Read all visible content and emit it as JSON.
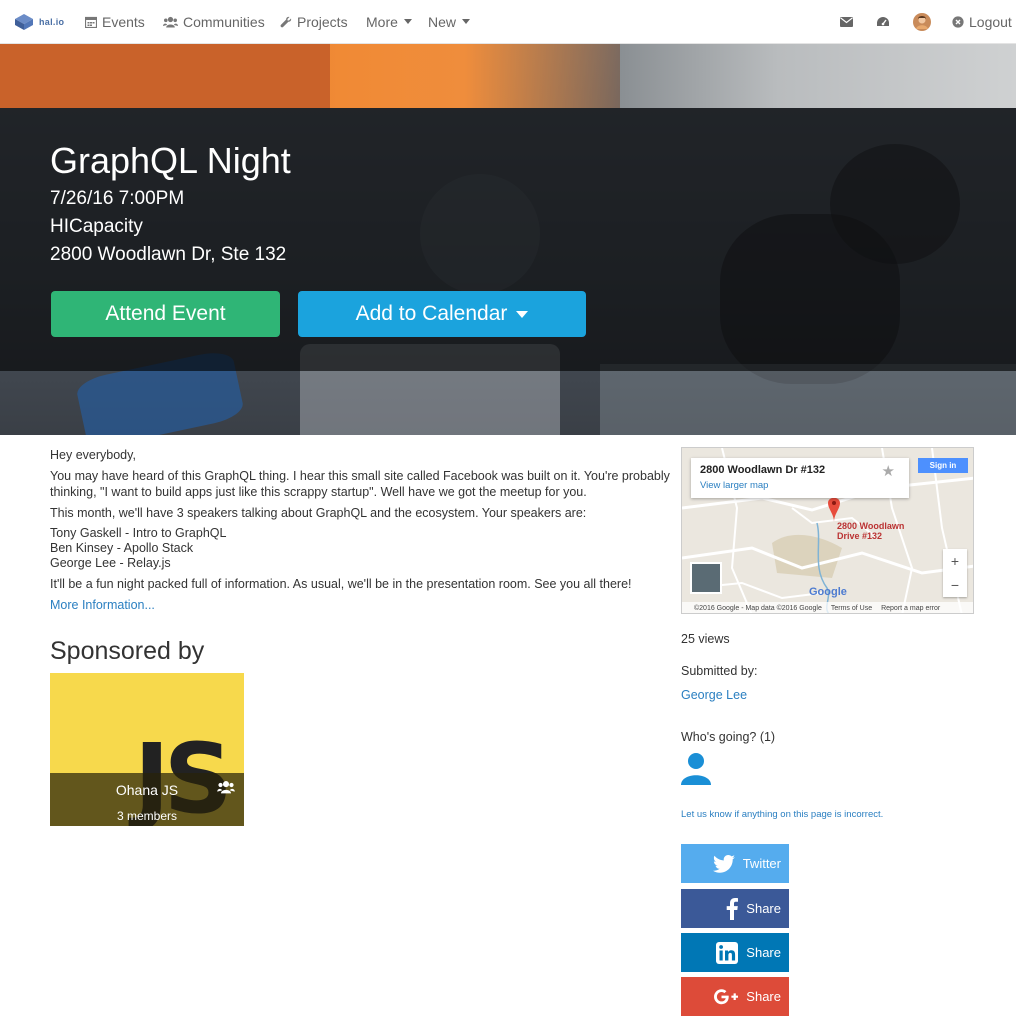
{
  "nav": {
    "logo_text": "hal.io",
    "items": [
      {
        "label": "Events",
        "icon": "calendar-icon"
      },
      {
        "label": "Communities",
        "icon": "users-icon"
      },
      {
        "label": "Projects",
        "icon": "wrench-icon"
      },
      {
        "label": "More",
        "icon": "caret-down-icon"
      },
      {
        "label": "New",
        "icon": "caret-down-icon"
      }
    ],
    "logout_label": "Logout"
  },
  "event": {
    "title": "GraphQL Night",
    "datetime": "7/26/16 7:00PM",
    "venue": "HICapacity",
    "address": "2800 Woodlawn Dr, Ste 132",
    "attend_label": "Attend Event",
    "calendar_label": "Add to Calendar"
  },
  "description": {
    "greeting": "Hey everybody,",
    "para1": "You may have heard of this GraphQL thing. I hear this small site called Facebook was built on it. You're probably thinking, \"I want to build apps just like this scrappy startup\". Well have we got the meetup for you.",
    "para2": "This month, we'll have 3 speakers talking about GraphQL and the ecosystem. Your speakers are:",
    "speakers": [
      "Tony Gaskell - Intro to GraphQL",
      "Ben Kinsey - Apollo Stack",
      "George Lee - Relay.js"
    ],
    "para3": "It'll be a fun night packed full of information. As usual, we'll be in the presentation room. See you all there!",
    "more_link": "More Information..."
  },
  "sponsors": {
    "heading": "Sponsored by",
    "name": "Ohana JS",
    "members": "3 members",
    "logo_text": "JS"
  },
  "map": {
    "title": "2800 Woodlawn Dr #132",
    "larger_link": "View larger map",
    "signin": "Sign in",
    "pin_label_1": "2800 Woodlawn",
    "pin_label_2": "Drive #132",
    "google": "Google",
    "attribution": "©2016 Google - Map data ©2016 Google",
    "terms": "Terms of Use",
    "report": "Report a map error"
  },
  "sidebar": {
    "views": "25 views",
    "submitted_by_label": "Submitted by:",
    "submitter": "George Lee",
    "going_label": "Who's going? (1)",
    "incorrect_link": "Let us know if anything on this page is incorrect."
  },
  "share": [
    {
      "label": "Twitter",
      "icon": "twitter-icon",
      "color": "#55acee"
    },
    {
      "label": "Share",
      "icon": "facebook-icon",
      "color": "#3b5998"
    },
    {
      "label": "Share",
      "icon": "linkedin-icon",
      "color": "#0077b5"
    },
    {
      "label": "Share",
      "icon": "google-plus-icon",
      "color": "#dd4b39"
    }
  ],
  "colors": {
    "attend": "#2fb576",
    "calendar": "#1ba3dd",
    "link": "#2a7fc1",
    "sponsor_bg": "#f7d94c"
  }
}
